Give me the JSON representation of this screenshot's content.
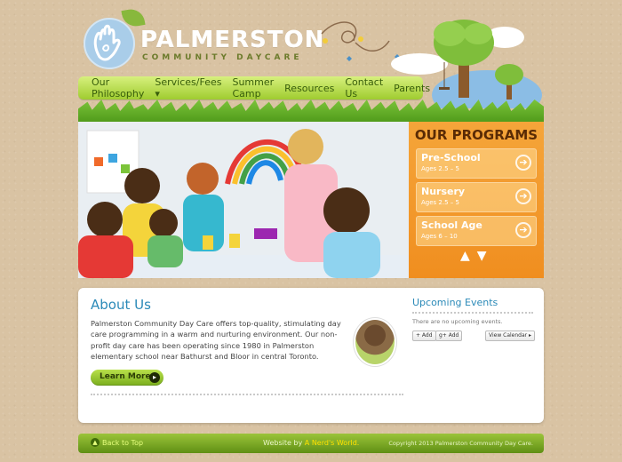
{
  "brand": {
    "name": "PALMERSTON",
    "tagline": "COMMUNITY DAYCARE",
    "colors": {
      "nav_green": "#9fcc2f",
      "accent_orange": "#f08e1f",
      "title_blue": "#2b8ab8"
    }
  },
  "nav": {
    "items": [
      "Our Philosophy",
      "Services/Fees ▾",
      "Summer Camp",
      "Resources",
      "Contact Us",
      "Parents"
    ]
  },
  "programs": {
    "title": "OUR PROGRAMS",
    "items": [
      {
        "name": "Pre-School",
        "ages": "Ages 2.5 – 5"
      },
      {
        "name": "Nursery",
        "ages": "Ages 2.5 – 5"
      },
      {
        "name": "School Age",
        "ages": "Ages 6 – 10"
      }
    ],
    "controls": {
      "up": "▲",
      "down": "▼"
    }
  },
  "about": {
    "title": "About Us",
    "text": "Palmerston Community Day Care offers top-quality, stimulating day care programming in a warm and nurturing environment. Our non-profit day care has been operating since 1980 in Palmerston elementary school near Bathurst and Bloor in central Toronto.",
    "button_label": "Learn More"
  },
  "events": {
    "title": "Upcoming Events",
    "empty_text": "There are no upcoming events.",
    "buttons": [
      "+ Add",
      "g+ Add",
      "View Calendar ▸"
    ]
  },
  "footer": {
    "back_to_top": "Back to Top",
    "credit_prefix": "Website by ",
    "credit_link": "A Nerd's World.",
    "copyright": "Copyright 2013 Palmerston Community Day Care."
  }
}
